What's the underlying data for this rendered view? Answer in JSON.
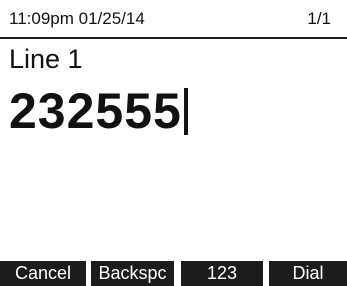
{
  "status_bar": {
    "datetime": "11:09pm  01/25/14",
    "page_indicator": "1/1"
  },
  "line": {
    "label": "Line 1"
  },
  "dial": {
    "number": "232555"
  },
  "softkeys": {
    "cancel": "Cancel",
    "backspace": "Backspc",
    "mode": "123",
    "dial": "Dial"
  },
  "colors": {
    "background": "#ffffff",
    "text": "#111111",
    "softkey_bg": "#1c1c1c",
    "softkey_text": "#ffffff"
  }
}
